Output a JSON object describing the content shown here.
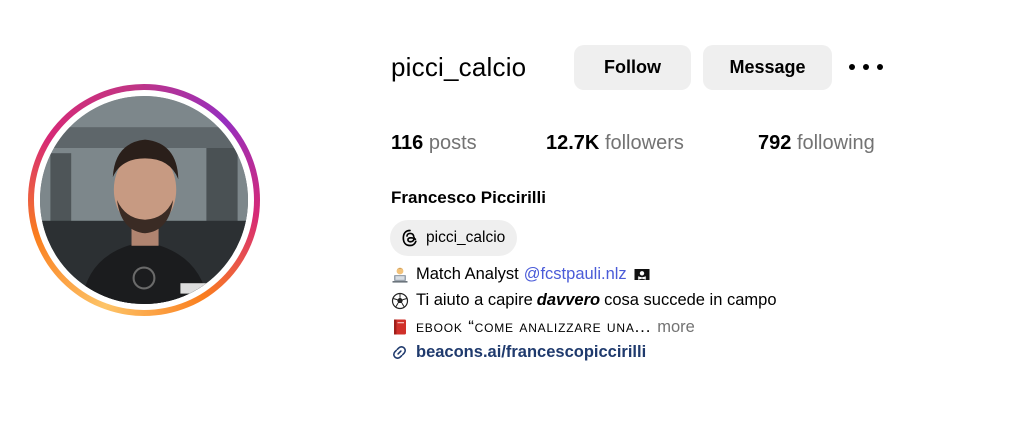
{
  "profile": {
    "username": "picci_calcio",
    "full_name": "Francesco Piccirilli",
    "threads_handle": "picci_calcio"
  },
  "actions": {
    "follow_label": "Follow",
    "message_label": "Message"
  },
  "stats": {
    "posts_count": "116",
    "posts_label": "posts",
    "followers_count": "12.7K",
    "followers_label": "followers",
    "following_count": "792",
    "following_label": "following"
  },
  "bio": {
    "line1_text": "Match Analyst",
    "line1_mention": "@fcstpauli.nlz",
    "line2_before": "Ti aiuto a capire",
    "line2_emph": "davvero",
    "line2_after": "cosa succede in campo",
    "line3_text": "ebook “come analizzare una...",
    "line3_more": "more",
    "link_text": "beacons.ai/francescopiccirilli"
  },
  "icons": {
    "line1_emoji": "technologist-emoji",
    "line1_flag": "pirate-flag-emoji",
    "line2_emoji": "soccer-ball-emoji",
    "line3_emoji": "red-book-emoji",
    "link": "link-icon",
    "threads": "threads-icon",
    "more": "more-options-icon"
  },
  "colors": {
    "button_bg": "#efefef",
    "mention": "#4a5bd8",
    "link": "#1f3a6d",
    "muted": "#737373"
  }
}
